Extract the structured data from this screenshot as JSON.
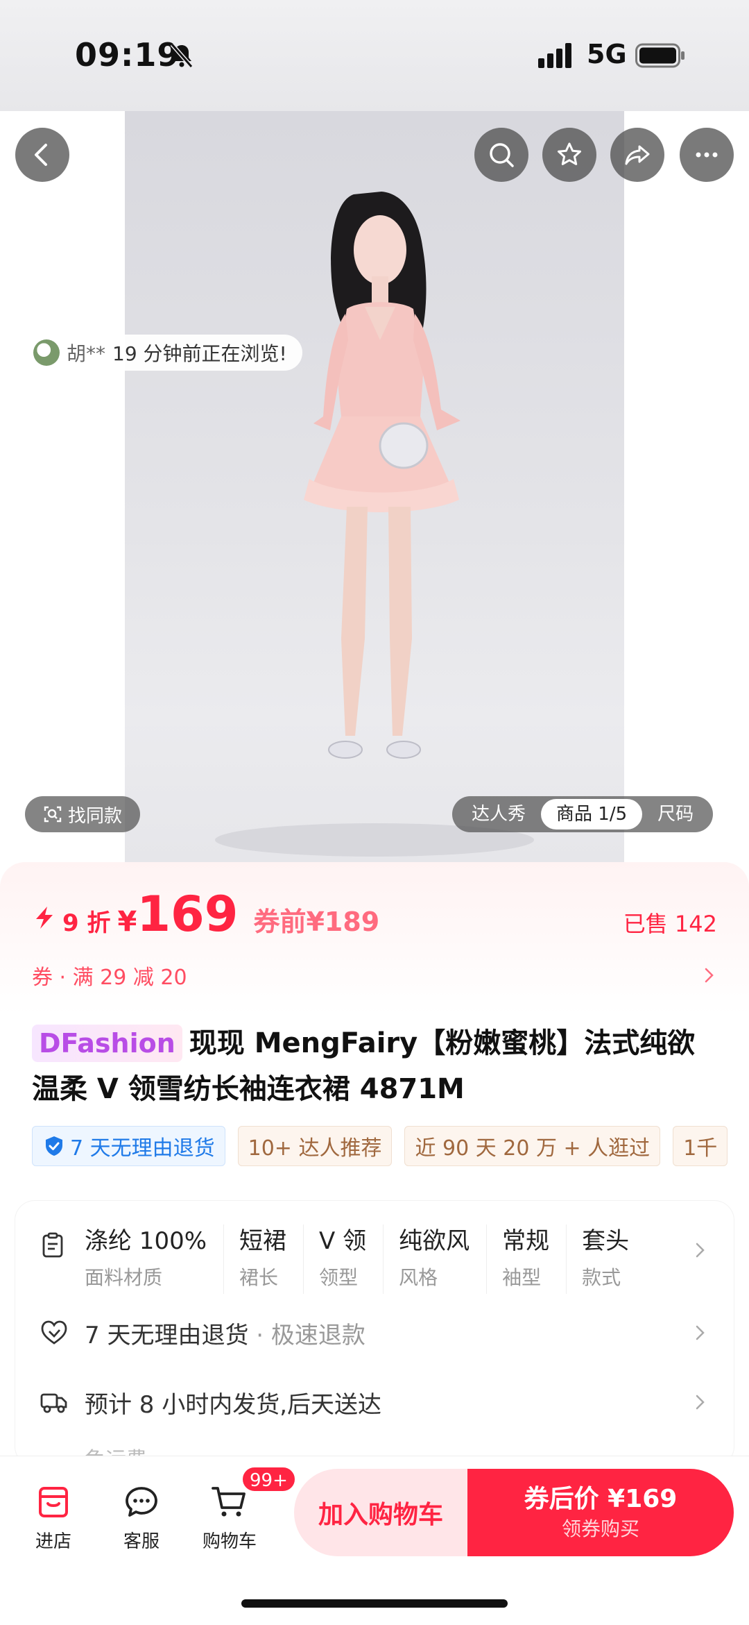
{
  "status_bar": {
    "time": "09:19",
    "network": "5G"
  },
  "hero": {
    "browse_user": "胡**",
    "browse_text": "19 分钟前正在浏览!",
    "find_same": "找同款",
    "tabs": [
      {
        "label": "达人秀",
        "active": false
      },
      {
        "label": "商品 1/5",
        "active": true
      },
      {
        "label": "尺码",
        "active": false
      }
    ]
  },
  "price": {
    "discount": "9 折",
    "currency": "¥",
    "amount": "169",
    "original": "券前¥189",
    "sold": "已售 142"
  },
  "coupon": {
    "text": "券 · 满 29 减 20"
  },
  "product": {
    "brand": "DFashion",
    "title": "现现 MengFairy【粉嫩蜜桃】法式纯欲温柔 V 领雪纺长袖连衣裙 4871M"
  },
  "tags": [
    {
      "label": "7 天无理由退货",
      "style": "blue"
    },
    {
      "label": "10+ 达人推荐",
      "style": "normal"
    },
    {
      "label": "近 90 天 20 万 + 人逛过",
      "style": "normal"
    },
    {
      "label": "1千",
      "style": "normal"
    }
  ],
  "specs": [
    {
      "value": "涤纶 100%",
      "key": "面料材质"
    },
    {
      "value": "短裙",
      "key": "裙长"
    },
    {
      "value": "V 领",
      "key": "领型"
    },
    {
      "value": "纯欲风",
      "key": "风格"
    },
    {
      "value": "常规",
      "key": "袖型"
    },
    {
      "value": "套头",
      "key": "款式"
    }
  ],
  "services": {
    "return": {
      "main": "7 天无理由退货",
      "sub": " · 极速退款"
    },
    "shipping": {
      "main": "预计 8 小时内发货,后天送达"
    },
    "freight_cut": "免运费"
  },
  "bottom_bar": {
    "store": "进店",
    "service": "客服",
    "cart": "购物车",
    "cart_badge": "99+",
    "add_cart": "加入购物车",
    "buy_main": "券后价 ¥169",
    "buy_sub": "领券购买"
  },
  "colors": {
    "accent": "#ff2442",
    "brand_tag": "#b84de6",
    "tag_blue": "#1f7ae8"
  }
}
